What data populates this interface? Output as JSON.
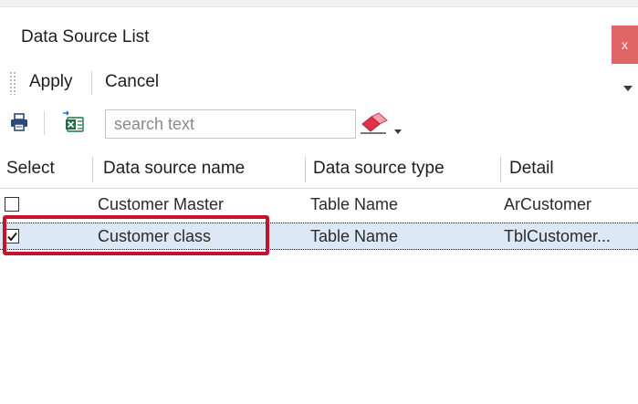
{
  "window": {
    "title": "Data Source List",
    "close_label": "x"
  },
  "menu": {
    "apply_label": "Apply",
    "cancel_label": "Cancel"
  },
  "toolbar": {
    "search_placeholder": "search text",
    "search_value": ""
  },
  "grid": {
    "columns": [
      "Select",
      "Data source name",
      "Data source type",
      "Detail"
    ],
    "rows": [
      {
        "selected": false,
        "name": "Customer Master",
        "type": "Table Name",
        "detail": "ArCustomer"
      },
      {
        "selected": true,
        "name": "Customer class",
        "type": "Table Name",
        "detail": "TblCustomer..."
      }
    ]
  },
  "colors": {
    "close_bg": "#e06565",
    "selected_row_bg": "#dde8f6",
    "highlight_border": "#c4122f",
    "excel_green": "#1e7145"
  },
  "icons": [
    "print-icon",
    "export-excel-icon",
    "eraser-icon",
    "dropdown-arrow-icon",
    "checkbox-icon"
  ]
}
